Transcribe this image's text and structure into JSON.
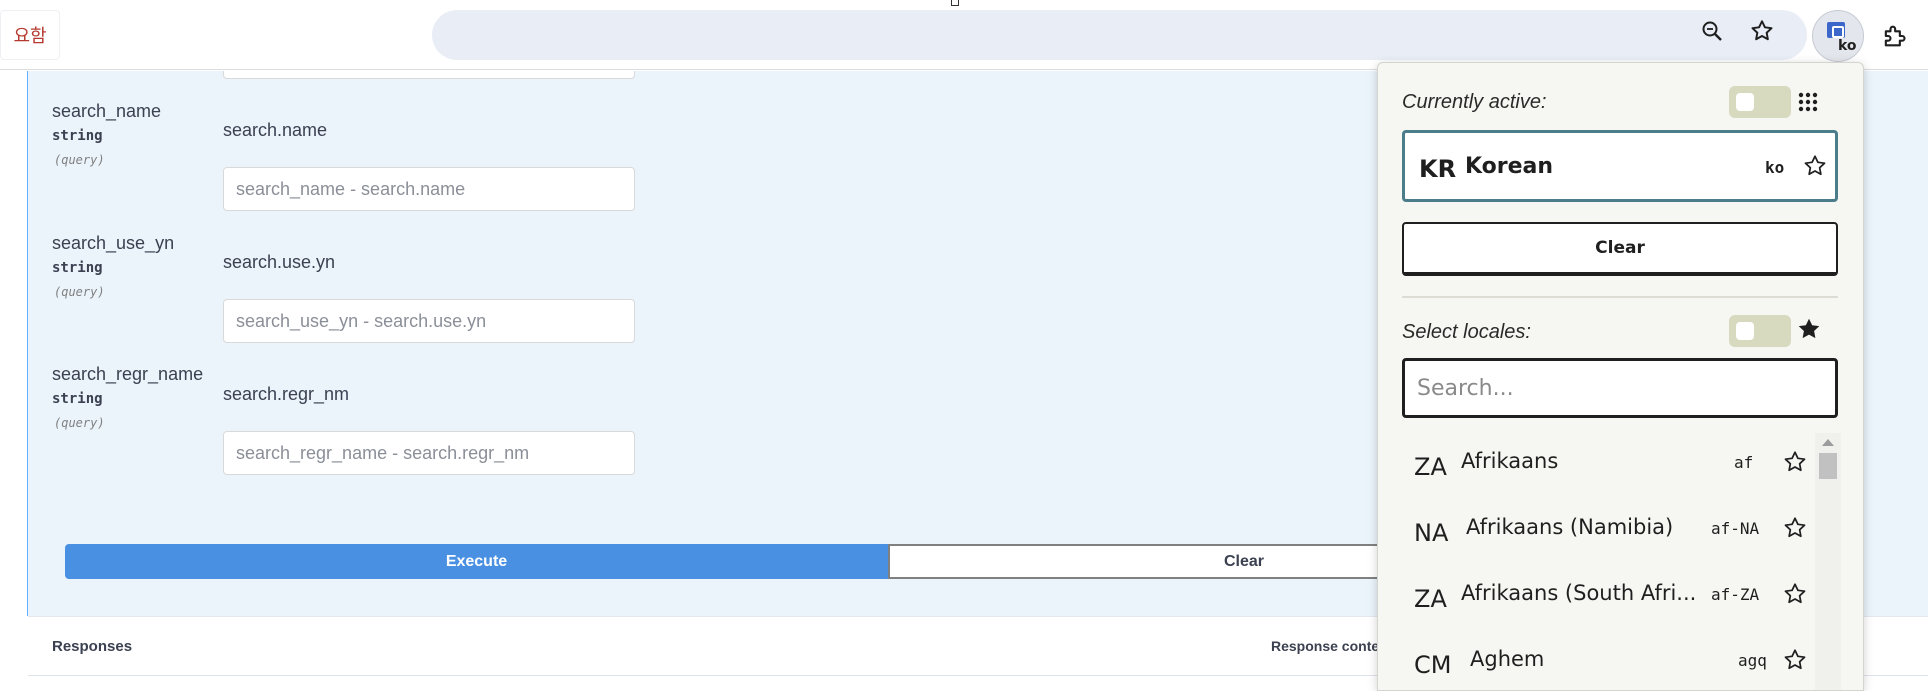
{
  "browser": {
    "tab_fragment": "요함",
    "locale_button_code": "ko",
    "icons": [
      "zoom-icon",
      "bookmark-star-icon",
      "locale-extension-icon",
      "puzzle-extensions-icon"
    ]
  },
  "params": [
    {
      "name": "search_name",
      "type": "string",
      "in": "(query)",
      "description": "search.name",
      "placeholder": "search_name - search.name"
    },
    {
      "name": "search_use_yn",
      "type": "string",
      "in": "(query)",
      "description": "search.use.yn",
      "placeholder": "search_use_yn - search.use.yn"
    },
    {
      "name": "search_regr_name",
      "type": "string",
      "in": "(query)",
      "description": "search.regr_nm",
      "placeholder": "search_regr_name - search.regr_nm"
    }
  ],
  "actions": {
    "execute": "Execute",
    "clear": "Clear"
  },
  "responses": {
    "title": "Responses",
    "content_type_label": "Response content type"
  },
  "popup": {
    "currently_active_label": "Currently active:",
    "active": {
      "region": "KR",
      "name": "Korean",
      "code": "ko"
    },
    "clear_label": "Clear",
    "select_locales_label": "Select locales:",
    "search_placeholder": "Search...",
    "locales": [
      {
        "region": "ZA",
        "name": "Afrikaans",
        "code": "af"
      },
      {
        "region": "NA",
        "name": "Afrikaans (Namibia)",
        "code": "af-NA"
      },
      {
        "region": "ZA",
        "name": "Afrikaans (South Afri...",
        "code": "af-ZA"
      },
      {
        "region": "CM",
        "name": "Aghem",
        "code": "agq"
      }
    ],
    "colors": {
      "active_border": "#4c7d8a",
      "toggle_bg": "#d8dac0",
      "panel_bg": "#f6f6f2"
    }
  },
  "colors": {
    "execute_bg": "#4990e2",
    "op_bg": "#ebf3fb"
  }
}
